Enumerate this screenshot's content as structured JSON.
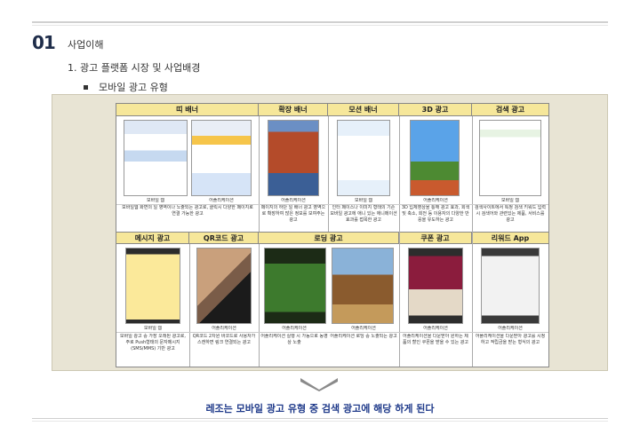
{
  "section": {
    "number": "01",
    "title": "사업이해"
  },
  "subtitle": "1. 광고 플랫폼 시장 및 사업배경",
  "bullet": "모바일 광고 유형",
  "row1": [
    {
      "header": "띠 배너",
      "captions": [
        "모바일 웹",
        "어플리케이션"
      ],
      "desc": "모바일웹 화면의 일 영역이나 노출되는 광고로, 클릭시 다양한 페이지로 연결 가능한 광고"
    },
    {
      "header": "확장 배너",
      "captions": [
        "어플리케이션"
      ],
      "desc": "페이지의 하단 일 배너 광고 영역으로 확장하여 많은 정보를 보여주는 광고"
    },
    {
      "header": "모션 배너",
      "captions": [
        "모바일 웹"
      ],
      "desc": "인터 페이스나 이미지 형태의 기존 모바일 광고에 애니 있는 애니메이션 효과를 접목한 광고"
    },
    {
      "header": "3D 광고",
      "captions": [
        "어플리케이션"
      ],
      "desc": "3D 입체영상을 통해 광고 효과, 회색 및 축소, 회전 등 이용자의 다양한 반응을 유도하는 광고"
    },
    {
      "header": "검색 광고",
      "captions": [
        "모바일 웹"
      ],
      "desc": "검색사이트에서 특정 검색 키워드 입력시 검색어와 관련있는 제품, 서비스를 광고"
    }
  ],
  "row2": [
    {
      "header": "메시지 광고",
      "captions": [
        "모바일 웹"
      ],
      "desc": "모바일 광고 중 가장 오래된 광고로, 주로 Push형태의 문자메시지(SMS/MMS) 기반 광고"
    },
    {
      "header": "QR코드 광고",
      "captions": [
        "어플리케이션"
      ],
      "desc": "QR코드 2차원 바코드로 사용자가 스캔하면 링크 연결되는 광고"
    },
    {
      "header": "로딩 광고",
      "captions": [
        "어플리케이션",
        "어플리케이션"
      ],
      "desc": "어플리케이션 실행 시 가동으로 동영상 노출",
      "desc2": "어플리케이션 로딩 중 노출되는 광고"
    },
    {
      "header": "쿠폰 광고",
      "captions": [
        "어플리케이션"
      ],
      "desc": "어플리케이션을 다운받아 원하는 제품의 할인 쿠폰을 받을 수 있는 광고"
    },
    {
      "header": "리워드 App",
      "captions": [
        "어플리케이션"
      ],
      "desc": "어플리케이션을 다운받아 광고를 시청하고 적립금을 받는 형식의 광고"
    }
  ],
  "conclusion": "레조는 모바일 광고 유형 중 검색 광고에 해당 하게 된다",
  "colors": {
    "header_bg": "#f6e79a",
    "accent": "#1f3a8a",
    "panel": "#e8e4d4"
  },
  "icons": [
    "chevron-down-icon"
  ]
}
